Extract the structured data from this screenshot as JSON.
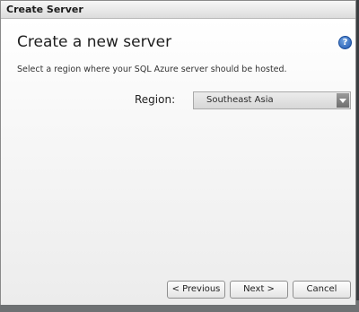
{
  "window": {
    "title": "Create Server"
  },
  "page": {
    "heading": "Create a new server",
    "help_symbol": "?",
    "description": "Select a region where your SQL Azure server should be hosted."
  },
  "region": {
    "label": "Region:",
    "selected": "Southeast Asia"
  },
  "buttons": {
    "previous": "< Previous",
    "next": "Next >",
    "cancel": "Cancel"
  },
  "colors": {
    "accent_help": "#1f57b0",
    "dialog_background": "#f3f3f3"
  },
  "icons": {
    "help": "help-icon",
    "dropdown": "chevron-down-icon"
  }
}
